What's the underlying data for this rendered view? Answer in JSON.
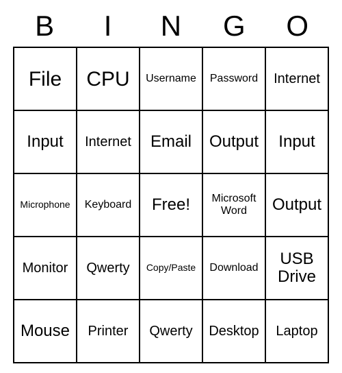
{
  "header": [
    "B",
    "I",
    "N",
    "G",
    "O"
  ],
  "grid": [
    [
      {
        "text": "File",
        "size": "fs-xl"
      },
      {
        "text": "CPU",
        "size": "fs-xl"
      },
      {
        "text": "Username",
        "size": "fs-s"
      },
      {
        "text": "Password",
        "size": "fs-s"
      },
      {
        "text": "Internet",
        "size": "fs-m"
      }
    ],
    [
      {
        "text": "Input",
        "size": "fs-l"
      },
      {
        "text": "Internet",
        "size": "fs-m"
      },
      {
        "text": "Email",
        "size": "fs-l"
      },
      {
        "text": "Output",
        "size": "fs-l"
      },
      {
        "text": "Input",
        "size": "fs-l"
      }
    ],
    [
      {
        "text": "Microphone",
        "size": "fs-xs"
      },
      {
        "text": "Keyboard",
        "size": "fs-s"
      },
      {
        "text": "Free!",
        "size": "fs-l"
      },
      {
        "text": "Microsoft Word",
        "size": "fs-s"
      },
      {
        "text": "Output",
        "size": "fs-l"
      }
    ],
    [
      {
        "text": "Monitor",
        "size": "fs-m"
      },
      {
        "text": "Qwerty",
        "size": "fs-m"
      },
      {
        "text": "Copy/Paste",
        "size": "fs-xs"
      },
      {
        "text": "Download",
        "size": "fs-s"
      },
      {
        "text": "USB Drive",
        "size": "fs-l"
      }
    ],
    [
      {
        "text": "Mouse",
        "size": "fs-l"
      },
      {
        "text": "Printer",
        "size": "fs-m"
      },
      {
        "text": "Qwerty",
        "size": "fs-m"
      },
      {
        "text": "Desktop",
        "size": "fs-m"
      },
      {
        "text": "Laptop",
        "size": "fs-m"
      }
    ]
  ]
}
